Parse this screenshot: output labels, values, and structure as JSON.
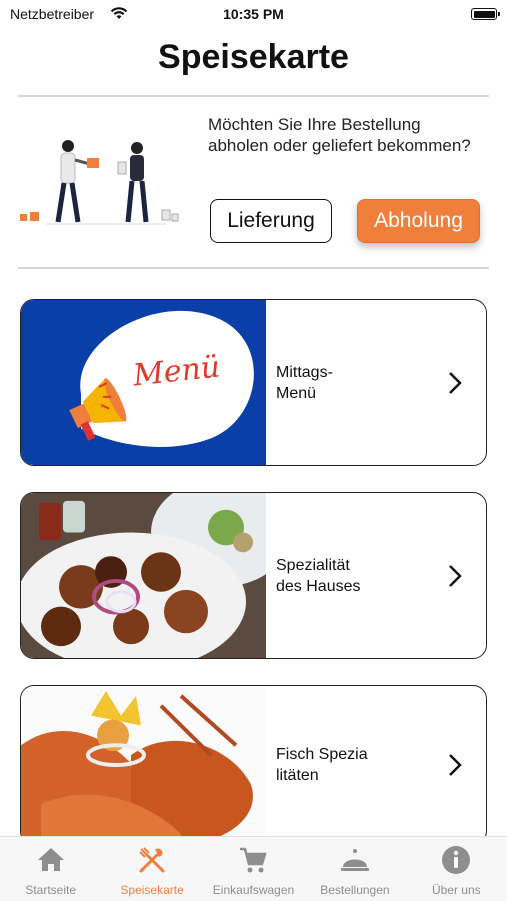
{
  "status_bar": {
    "carrier": "Netzbetreiber",
    "time": "10:35 PM"
  },
  "header": {
    "title": "Speisekarte"
  },
  "delivery": {
    "prompt": "Möchten Sie Ihre Bestellung abholen oder geliefert bekommen?",
    "delivery_label": "Lieferung",
    "pickup_label": "Abholung",
    "selected": "Abholung"
  },
  "categories": [
    {
      "label": "Mittags-\nMenü",
      "image_text": "Menü",
      "image": "megaphone-menu-illustration"
    },
    {
      "label": "Spezialität\ndes Hauses",
      "image": "grilled-meat-platter-photo"
    },
    {
      "label": "Fisch Spezia\nlitäten",
      "image": "grilled-prawns-photo"
    }
  ],
  "tabs": [
    {
      "label": "Startseite",
      "icon": "home-icon"
    },
    {
      "label": "Speisekarte",
      "icon": "fork-knife-icon",
      "active": true
    },
    {
      "label": "Einkaufswagen",
      "icon": "cart-icon"
    },
    {
      "label": "Bestellungen",
      "icon": "cloche-icon"
    },
    {
      "label": "Über uns",
      "icon": "info-icon"
    }
  ],
  "colors": {
    "accent": "#f07f3c",
    "menu_blue": "#0a3fa8",
    "inactive": "#8e8e8e"
  }
}
